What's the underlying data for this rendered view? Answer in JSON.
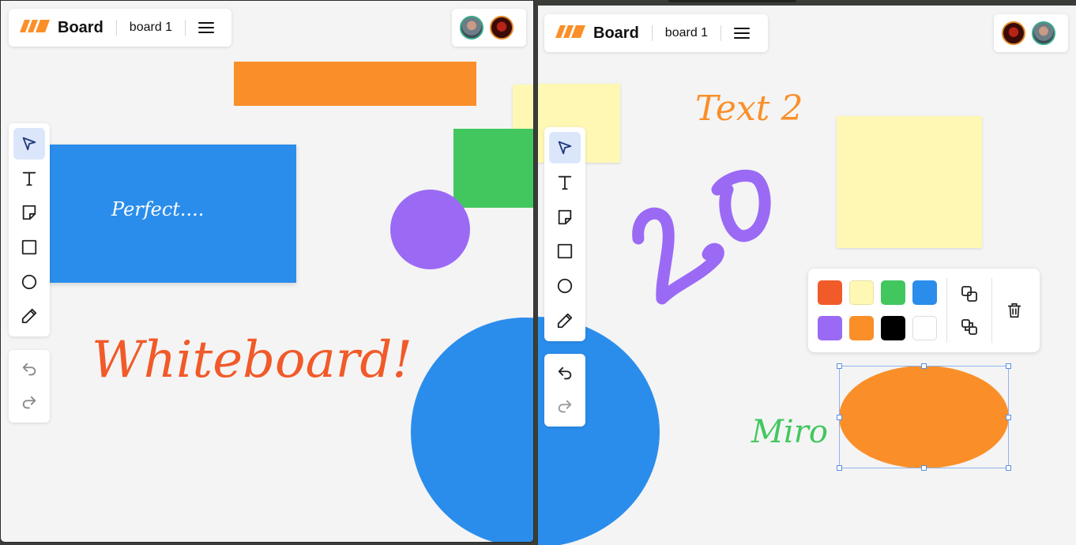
{
  "left": {
    "header": {
      "title": "Board",
      "board_name": "board 1"
    },
    "canvas": {
      "blue_rect_text": "Perfect....",
      "big_text": "Whiteboard!"
    }
  },
  "right": {
    "header": {
      "title": "Board",
      "board_name": "board 1"
    },
    "canvas": {
      "text2": "Text 2",
      "scribble_text": "20",
      "miro_text": "Miro"
    },
    "palette": {
      "colors": [
        "#F15A29",
        "#FFF8B5",
        "#42C75F",
        "#2B8DEB",
        "#9B6AF5",
        "#FA8F2A",
        "#000000",
        "#FFFFFF"
      ]
    }
  },
  "colors": {
    "orange": "#FA8F2A",
    "green": "#42C75F",
    "blue": "#2B8DEB",
    "purple": "#9B6AF5",
    "sticky_yellow": "#FFF8B5",
    "red_text": "#F15A29",
    "selection": "#5B8EE6"
  },
  "icons": [
    "logo-icon",
    "menu-icon",
    "select-tool-icon",
    "text-tool-icon",
    "sticky-note-tool-icon",
    "rectangle-tool-icon",
    "circle-tool-icon",
    "pencil-tool-icon",
    "undo-icon",
    "redo-icon",
    "bring-forward-icon",
    "send-backward-icon",
    "trash-icon"
  ]
}
